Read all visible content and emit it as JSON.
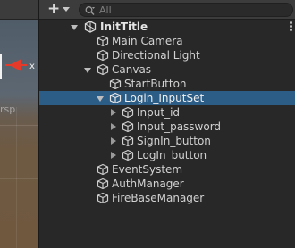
{
  "search": {
    "placeholder": "All"
  },
  "scene_view": {
    "label": "rsp"
  },
  "hierarchy": {
    "scene": {
      "name": "InitTitle",
      "expanded": true
    },
    "items": [
      {
        "label": "Main Camera",
        "depth": 1
      },
      {
        "label": "Directional Light",
        "depth": 1
      },
      {
        "label": "Canvas",
        "depth": 1,
        "expanded": true
      },
      {
        "label": "StartButton",
        "depth": 2
      },
      {
        "label": "Login_InputSet",
        "depth": 2,
        "expanded": true,
        "selected": true
      },
      {
        "label": "Input_id",
        "depth": 3,
        "collapsed": true
      },
      {
        "label": "Input_password",
        "depth": 3,
        "collapsed": true
      },
      {
        "label": "SignIn_button",
        "depth": 3,
        "collapsed": true
      },
      {
        "label": "LogIn_button",
        "depth": 3,
        "collapsed": true
      },
      {
        "label": "EventSystem",
        "depth": 1
      },
      {
        "label": "AuthManager",
        "depth": 1
      },
      {
        "label": "FireBaseManager",
        "depth": 1
      }
    ]
  },
  "colors": {
    "selection": "#2c5d87",
    "panel": "#282828",
    "toolbar": "#3c3c3c"
  }
}
